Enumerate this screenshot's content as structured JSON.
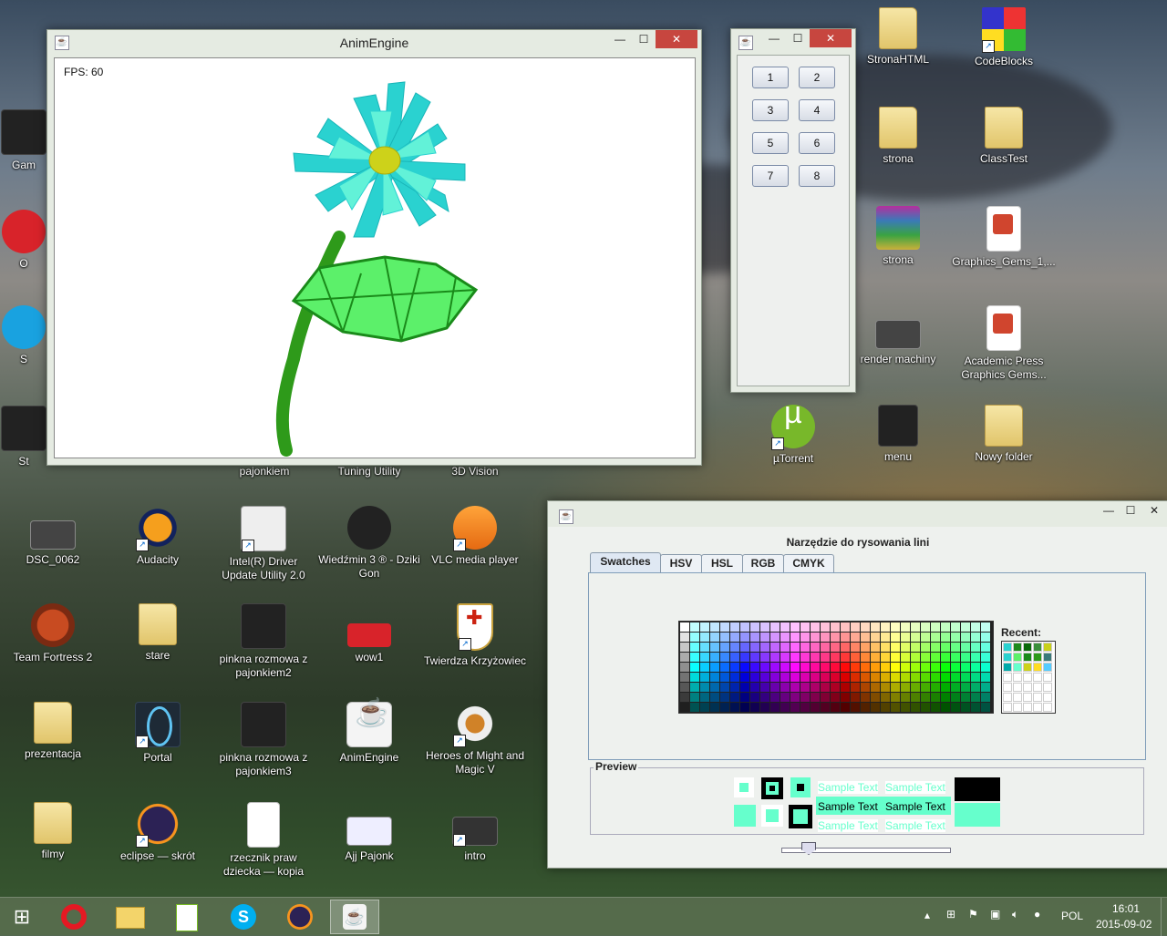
{
  "desktop": {
    "icons": [
      {
        "label": "StronaHTML",
        "type": "folder-pdf-icon"
      },
      {
        "label": "CodeBlocks",
        "type": "codeblocks-icon"
      },
      {
        "label": "strona",
        "type": "folder-pdf-icon"
      },
      {
        "label": "ClassTest",
        "type": "folder-icon"
      },
      {
        "label": "strona",
        "type": "winrar-icon"
      },
      {
        "label": "Graphics_Gems_1,...",
        "type": "pdf-icon"
      },
      {
        "label": "render machiny",
        "type": "image-icon"
      },
      {
        "label": "Academic Press\nGraphics Gems...",
        "type": "pdf-icon"
      },
      {
        "label": "µTorrent",
        "type": "utorrent-icon"
      },
      {
        "label": "menu",
        "type": "dark-image-icon"
      },
      {
        "label": "Nowy folder",
        "type": "folder-icon"
      },
      {
        "label": "pajonkiem",
        "type": "partial"
      },
      {
        "label": "Tuning Utility",
        "type": "partial"
      },
      {
        "label": "3D Vision",
        "type": "partial"
      },
      {
        "label": "DSC_0062",
        "type": "photo-icon"
      },
      {
        "label": "Audacity",
        "type": "audacity-icon"
      },
      {
        "label": "Intel(R) Driver\nUpdate Utility 2.0",
        "type": "intel-icon"
      },
      {
        "label": "Wiedźmin 3 ® - Dziki\nGon",
        "type": "witcher-icon"
      },
      {
        "label": "VLC media player",
        "type": "vlc-icon"
      },
      {
        "label": "Team Fortress 2",
        "type": "tf2-icon"
      },
      {
        "label": "stare",
        "type": "folder-icon"
      },
      {
        "label": "pinkna rozmowa z\npajonkiem2",
        "type": "dark-image-icon"
      },
      {
        "label": "wow1",
        "type": "red-image-icon"
      },
      {
        "label": "Twierdza Krzyżowiec",
        "type": "shield-icon"
      },
      {
        "label": "prezentacja",
        "type": "folder-icon"
      },
      {
        "label": "Portal",
        "type": "portal-icon"
      },
      {
        "label": "pinkna rozmowa z\npajonkiem3",
        "type": "dark-image-icon"
      },
      {
        "label": "AnimEngine",
        "type": "java-icon"
      },
      {
        "label": "Heroes of Might and\nMagic V",
        "type": "heroes-icon"
      },
      {
        "label": "filmy",
        "type": "folder-icon"
      },
      {
        "label": "eclipse — skrót",
        "type": "eclipse-icon"
      },
      {
        "label": "rzecznik praw\ndziecka — kopia",
        "type": "document-icon"
      },
      {
        "label": "Ajj Pajonk",
        "type": "image-icon"
      },
      {
        "label": "intro",
        "type": "video-icon"
      }
    ],
    "partial_left_labels": [
      "Gam",
      "O",
      "S",
      "St"
    ]
  },
  "anim_window": {
    "title": "AnimEngine",
    "fps_text": "FPS: 60",
    "controls": {
      "minimize": "—",
      "maximize": "☐",
      "close": "✕"
    }
  },
  "pad_window": {
    "buttons": [
      "1",
      "2",
      "3",
      "4",
      "5",
      "6",
      "7",
      "8"
    ],
    "controls": {
      "minimize": "—",
      "maximize": "☐",
      "close": "✕"
    }
  },
  "chooser_window": {
    "heading": "Narzędzie do rysowania lini",
    "tabs": [
      "Swatches",
      "HSV",
      "HSL",
      "RGB",
      "CMYK"
    ],
    "active_tab": "Swatches",
    "recent_label": "Recent:",
    "preview_label": "Preview",
    "sample_text": "Sample Text",
    "selected_color": "#66ffcc",
    "controls": {
      "minimize": "—",
      "maximize": "☐",
      "close": "✕"
    }
  },
  "taskbar": {
    "items": [
      "windows-start-icon",
      "opera-icon",
      "file-explorer-icon",
      "notepad-plus-icon",
      "skype-icon",
      "eclipse-icon",
      "java-icon"
    ],
    "language": "POL",
    "time": "16:01",
    "date": "2015-09-02"
  }
}
